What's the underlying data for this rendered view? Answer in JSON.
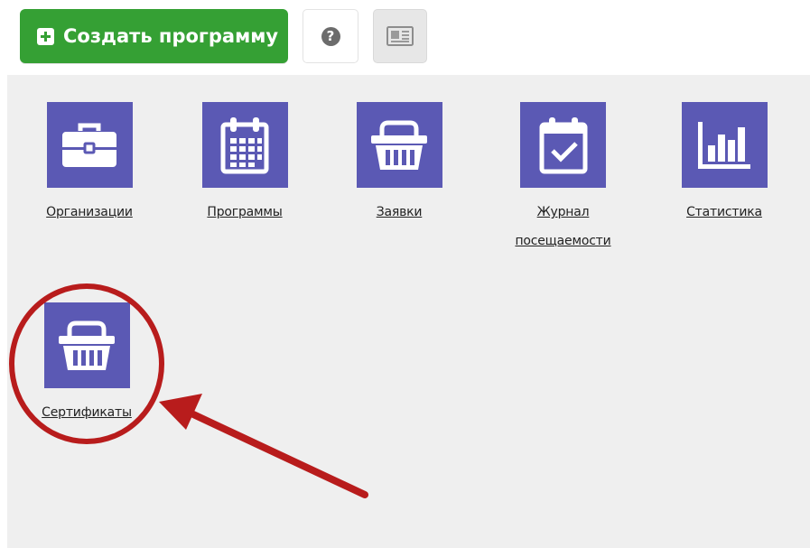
{
  "toolbar": {
    "create_label": "Создать программу",
    "help_label": "?"
  },
  "tiles": [
    {
      "label": "Организации",
      "icon": "briefcase-icon"
    },
    {
      "label": "Программы",
      "icon": "calendar-grid-icon"
    },
    {
      "label": "Заявки",
      "icon": "basket-icon"
    },
    {
      "label_line1": "Журнал",
      "label_line2": "посещаемости",
      "icon": "calendar-check-icon"
    },
    {
      "label": "Статистика",
      "icon": "bar-chart-icon"
    },
    {
      "label": "Сертификаты",
      "icon": "basket-icon"
    }
  ],
  "colors": {
    "primary_button": "#35a034",
    "tile_icon_bg": "#5b59b4",
    "panel_bg": "#efefef",
    "annotation": "#b81c1c"
  }
}
